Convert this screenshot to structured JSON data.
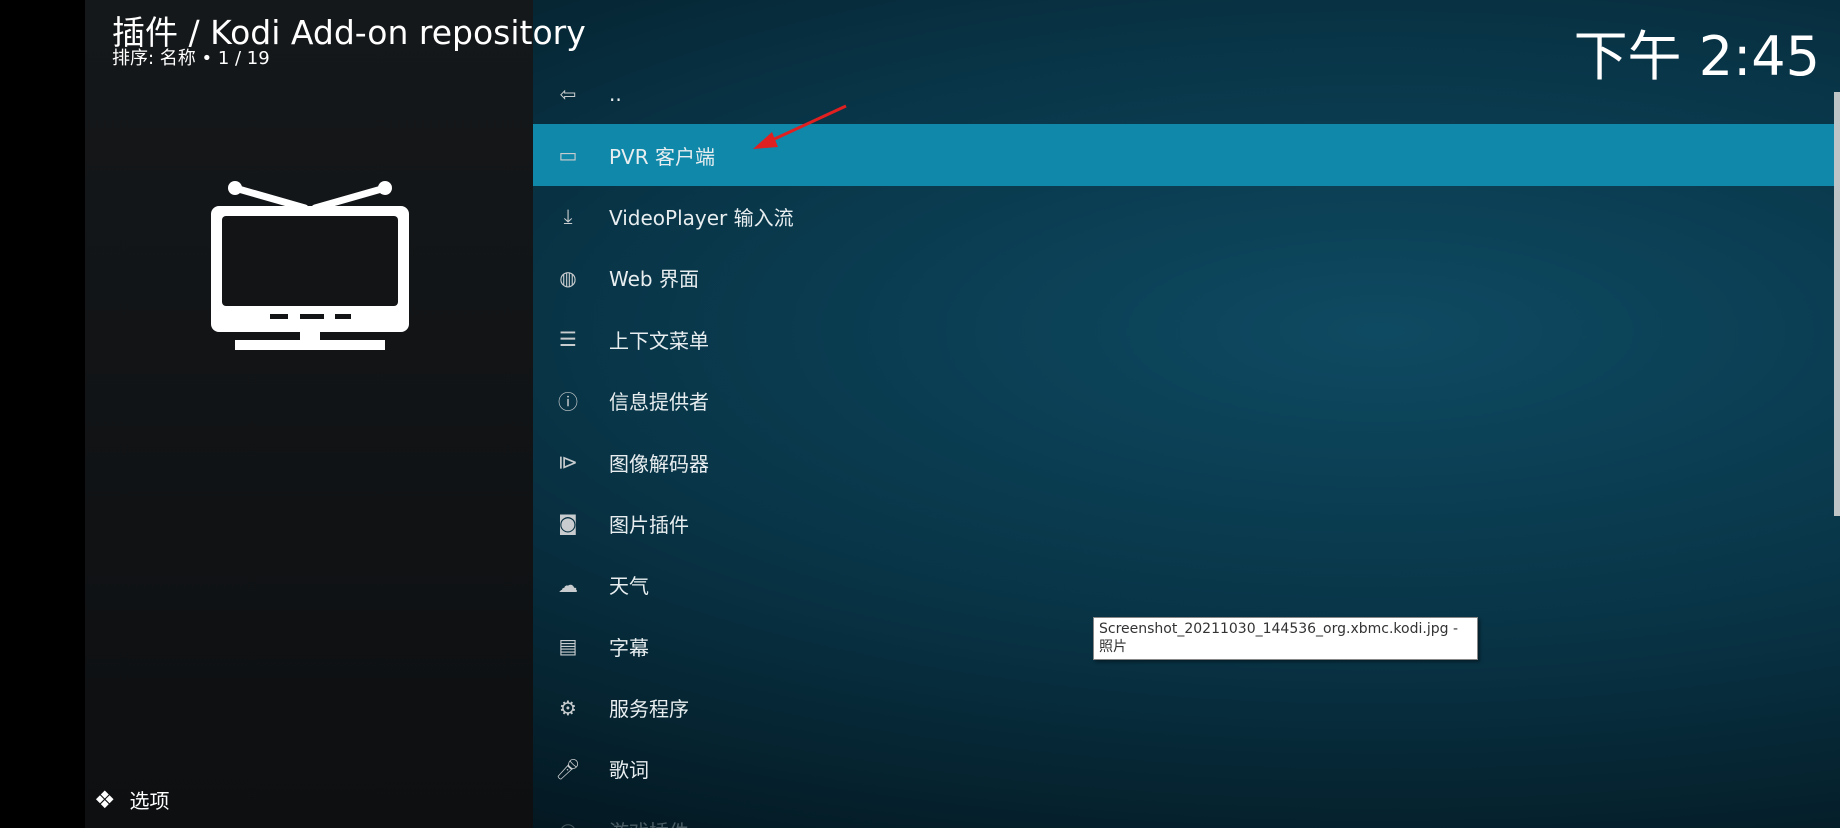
{
  "header": {
    "title": "插件 / Kodi Add-on repository",
    "sort_info": "排序: 名称  •  1 / 19",
    "clock": "下午 2:45"
  },
  "footer": {
    "options_label": "选项"
  },
  "list": {
    "items": [
      {
        "label": "..",
        "icon": "folder-back-icon"
      },
      {
        "label": "PVR 客户端",
        "icon": "tv-icon",
        "selected": true
      },
      {
        "label": "VideoPlayer 输入流",
        "icon": "download-tray-icon"
      },
      {
        "label": "Web 界面",
        "icon": "globe-icon"
      },
      {
        "label": "上下文菜单",
        "icon": "context-menu-icon"
      },
      {
        "label": "信息提供者",
        "icon": "info-icon"
      },
      {
        "label": "图像解码器",
        "icon": "image-decoder-icon"
      },
      {
        "label": "图片插件",
        "icon": "camera-icon"
      },
      {
        "label": "天气",
        "icon": "weather-icon"
      },
      {
        "label": "字幕",
        "icon": "subtitles-icon"
      },
      {
        "label": "服务程序",
        "icon": "gear-icon"
      },
      {
        "label": "歌词",
        "icon": "microphone-icon"
      },
      {
        "label": "游戏插件",
        "icon": "gamepad-icon"
      }
    ]
  },
  "tooltip": {
    "text": "Screenshot_20211030_144536_org.xbmc.kodi.jpg - 照片"
  },
  "colors": {
    "selection": "#1088aa",
    "annotation_arrow": "#e02020"
  }
}
